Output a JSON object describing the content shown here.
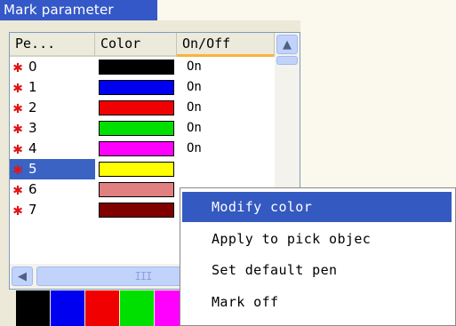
{
  "window": {
    "title": "Mark parameter"
  },
  "columns": [
    {
      "label": "Pe..."
    },
    {
      "label": "Color"
    },
    {
      "label": "On/Off"
    }
  ],
  "pens": [
    {
      "num": "0",
      "color": "#000000",
      "state": "On"
    },
    {
      "num": "1",
      "color": "#0000f0",
      "state": "On"
    },
    {
      "num": "2",
      "color": "#f00000",
      "state": "On"
    },
    {
      "num": "3",
      "color": "#00e000",
      "state": "On"
    },
    {
      "num": "4",
      "color": "#ff00ff",
      "state": "On"
    },
    {
      "num": "5",
      "color": "#ffff00",
      "state": ""
    },
    {
      "num": "6",
      "color": "#e08080",
      "state": ""
    },
    {
      "num": "7",
      "color": "#800000",
      "state": ""
    }
  ],
  "selected_pen": "5",
  "scrollbar": {
    "h_thumb_grip": "III"
  },
  "palette": [
    "#000000",
    "#0000f0",
    "#f00000",
    "#00e000",
    "#ff00ff"
  ],
  "context_menu": {
    "items": [
      {
        "label": "Modify color",
        "highlighted": true
      },
      {
        "label": "Apply to pick objec",
        "highlighted": false
      },
      {
        "label": "Set default pen",
        "highlighted": false
      },
      {
        "label": "Mark off",
        "highlighted": false
      }
    ]
  },
  "icons": {
    "pen_marker": "✱",
    "scroll_up": "▲",
    "scroll_left": "◀"
  }
}
